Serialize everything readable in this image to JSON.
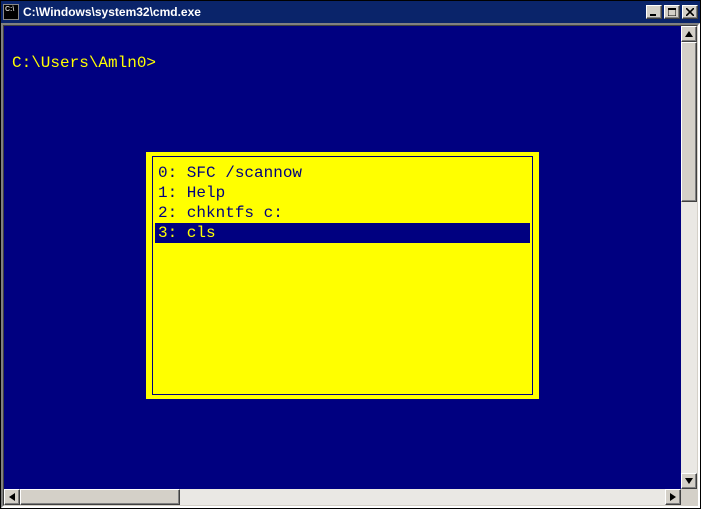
{
  "window": {
    "title": "C:\\Windows\\system32\\cmd.exe"
  },
  "console": {
    "prompt": "C:\\Users\\Amln0>"
  },
  "popup": {
    "items": [
      {
        "index": "0",
        "text": "SFC /scannow",
        "selected": false
      },
      {
        "index": "1",
        "text": "Help",
        "selected": false
      },
      {
        "index": "2",
        "text": "chkntfs c:",
        "selected": false
      },
      {
        "index": "3",
        "text": "cls",
        "selected": true
      }
    ]
  }
}
